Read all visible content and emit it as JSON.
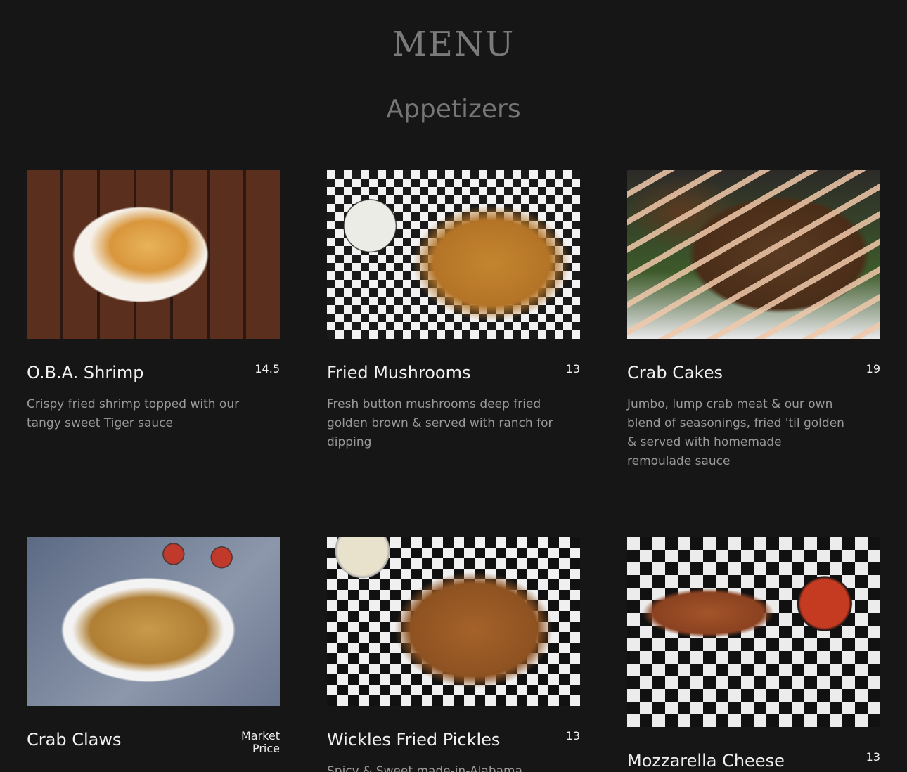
{
  "header": {
    "menu_title": "MENU",
    "section_title": "Appetizers"
  },
  "items": [
    {
      "name": "O.B.A. Shrimp",
      "price": "14.5",
      "description": "Crispy fried shrimp topped with our tangy sweet Tiger sauce",
      "image_icon": "fried-shrimp-photo"
    },
    {
      "name": "Fried Mushrooms",
      "price": "13",
      "description": "Fresh button mushrooms deep fried golden brown & served with ranch for dipping",
      "image_icon": "fried-mushrooms-photo"
    },
    {
      "name": "Crab Cakes",
      "price": "19",
      "description": "Jumbo, lump crab meat & our own blend of seasonings, fried 'til golden & served with homemade remoulade sauce",
      "image_icon": "crab-cakes-photo"
    },
    {
      "name": "Crab Claws",
      "price_line1": "Market",
      "price_line2": "Price",
      "description": "",
      "image_icon": "crab-claws-photo"
    },
    {
      "name": "Wickles Fried Pickles",
      "price": "13",
      "description": "Spicy & Sweet made-in-Alabama",
      "image_icon": "fried-pickles-photo"
    },
    {
      "name": "Mozzarella Cheese",
      "price": "13",
      "description": "",
      "image_icon": "mozzarella-sticks-photo"
    }
  ],
  "colors": {
    "background": "#161616",
    "title": "#7a7a7a",
    "item_name": "#f0f0f0",
    "description": "#9a9a9a"
  }
}
